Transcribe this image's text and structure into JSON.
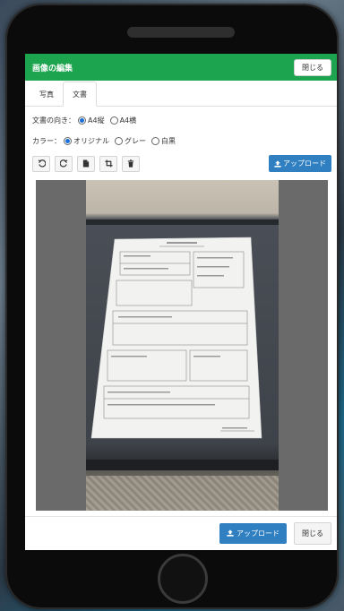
{
  "header": {
    "title": "画像の編集",
    "close_label": "閉じる"
  },
  "tabs": [
    {
      "label": "写真",
      "active": false
    },
    {
      "label": "文書",
      "active": true
    }
  ],
  "orientation": {
    "label": "文書の向き：",
    "options": [
      {
        "label": "A4縦",
        "checked": true
      },
      {
        "label": "A4横",
        "checked": false
      }
    ]
  },
  "color": {
    "label": "カラー：",
    "options": [
      {
        "label": "オリジナル",
        "checked": true
      },
      {
        "label": "グレー",
        "checked": false
      },
      {
        "label": "白黒",
        "checked": false
      }
    ]
  },
  "toolbar": {
    "tools": [
      {
        "icon": "rotate-left-icon"
      },
      {
        "icon": "rotate-right-icon"
      },
      {
        "icon": "document-icon"
      },
      {
        "icon": "crop-icon"
      },
      {
        "icon": "trash-icon"
      }
    ],
    "upload_label": "アップロード"
  },
  "footer": {
    "upload_label": "アップロード",
    "close_label": "閉じる"
  },
  "colors": {
    "header_green": "#1ca54e",
    "upload_blue": "#2f7fc1",
    "radio_blue": "#1a6fd6"
  }
}
